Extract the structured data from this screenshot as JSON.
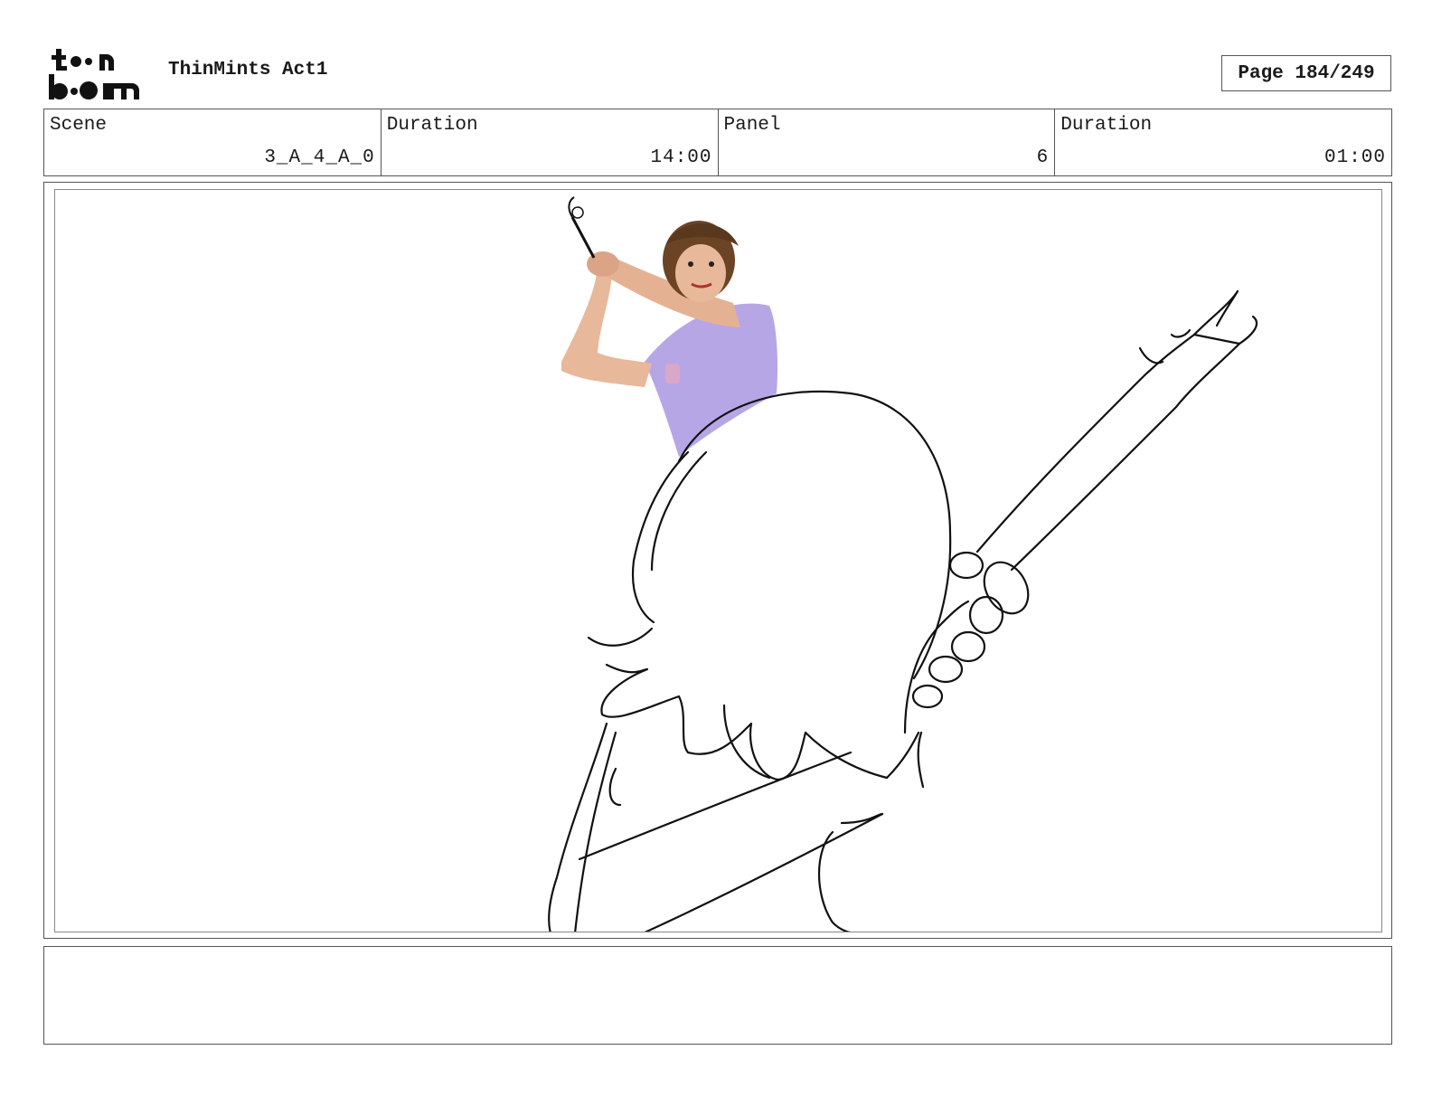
{
  "header": {
    "logo_text": "toon boom",
    "document_title": "ThinMints Act1",
    "page_indicator": "Page 184/249"
  },
  "info": {
    "scene_label": "Scene",
    "scene_value": "3_A_4_A_0",
    "scene_duration_label": "Duration",
    "scene_duration_value": "14:00",
    "panel_label": "Panel",
    "panel_value": "6",
    "panel_duration_label": "Duration",
    "panel_duration_value": "01:00"
  },
  "panel": {
    "image_description": "reference-photo-and-sketch",
    "shirt_color": "#b7a6e6",
    "hair_color": "#6b4426",
    "skin_color": "#e8b89a"
  },
  "notes": {
    "text": ""
  }
}
